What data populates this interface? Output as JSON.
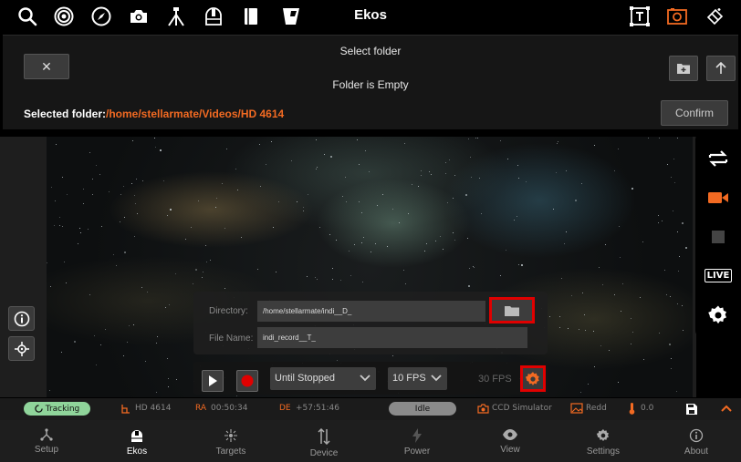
{
  "app_title": "Ekos",
  "toolbar": {
    "left_icons": [
      "search-icon",
      "target-icon",
      "compass-icon",
      "camera-icon",
      "tripod-icon",
      "observatory-icon",
      "notebook-icon",
      "filter-icon"
    ],
    "right_icons": [
      "text-overlay-icon",
      "capture-frame-icon",
      "clear-icon"
    ],
    "accent_icon": "capture-frame-icon"
  },
  "dialog": {
    "title": "Select folder",
    "empty_message": "Folder is Empty",
    "close_label": "✕",
    "selected_label": "Selected folder:",
    "selected_path": "/home/stellarmate/Videos/HD 4614",
    "confirm_label": "Confirm"
  },
  "recording": {
    "directory_label": "Directory:",
    "directory_value": "/home/stellarmate/indi__D_",
    "filename_label": "File Name:",
    "filename_value": "indi_record__T_",
    "duration_mode": "Until Stopped",
    "fps_select": "10 FPS",
    "fps_readout": "30 FPS"
  },
  "right_bar": {
    "live_label": "LIVE"
  },
  "status": {
    "tracking": "Tracking",
    "target": "HD 4614",
    "ra_label": "RA",
    "ra_value": "00:50:34",
    "de_label": "DE",
    "de_value": "+57:51:46",
    "idle": "Idle",
    "camera": "CCD Simulator",
    "frame": "Redd",
    "temperature": "0.0"
  },
  "nav": [
    {
      "label": "Setup",
      "icon": "setup-icon"
    },
    {
      "label": "Ekos",
      "icon": "ekos-icon"
    },
    {
      "label": "Targets",
      "icon": "targets-icon"
    },
    {
      "label": "Device",
      "icon": "device-icon"
    },
    {
      "label": "Power",
      "icon": "power-icon"
    },
    {
      "label": "View",
      "icon": "view-icon"
    },
    {
      "label": "Settings",
      "icon": "settings-icon"
    },
    {
      "label": "About",
      "icon": "about-icon"
    }
  ],
  "colors": {
    "accent": "#f26a22",
    "highlight_border": "#e00000",
    "tracking_green": "#8fd49a",
    "record_red": "#e00000"
  }
}
